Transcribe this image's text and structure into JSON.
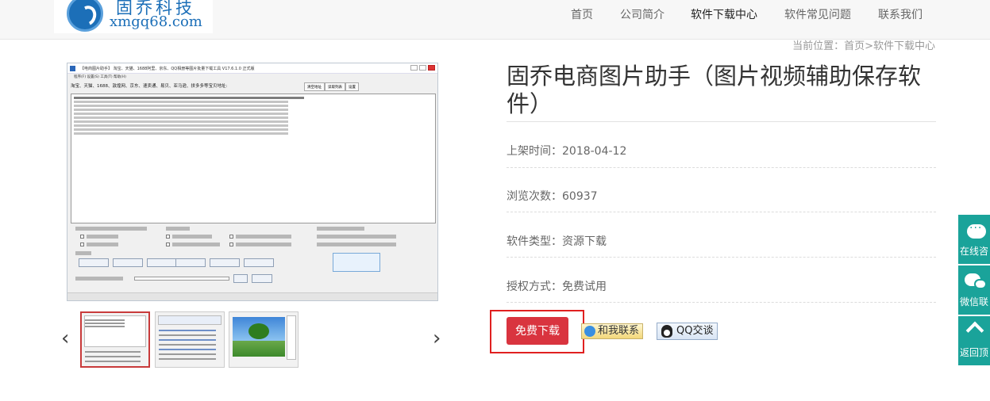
{
  "header": {
    "logo_cn": "固乔科技",
    "logo_url": "xmgq68.com",
    "nav": [
      "首页",
      "公司简介",
      "软件下载中心",
      "软件常见问题",
      "联系我们"
    ],
    "nav_active": "软件下载中心"
  },
  "breadcrumb": "当前位置：首页>软件下载中心",
  "product": {
    "title": "固乔电商图片助手（图片视频辅助保存软件）",
    "release": "上架时间：2018-04-12",
    "views": "浏览次数：60937",
    "type": "软件类型：资源下载",
    "license": "授权方式：免费试用"
  },
  "actions": {
    "download": "免费下载",
    "contact": "和我联系",
    "qq": "QQ交谈"
  },
  "screenshot": {
    "window_title": "【电商图片助手】 淘宝、天猫、1688阿里、京东、QQ相册等图片批量下载工具 V17.6.1.0 正式版",
    "menu": "程序(F)    设置(S)    工具(T)    帮助(H)",
    "url_label": "淘宝、天猫、1688、敦煌网、京东、速卖通、易贝、亚马逊、拼多多等宝贝地址:",
    "btn_clear": "清空地址",
    "btn_read": "读取列表",
    "btn_set": "设置"
  },
  "side": {
    "online": "在线咨",
    "wechat": "微信联",
    "top": "返回顶"
  },
  "colors": {
    "accent_red": "#d9343f",
    "side_teal": "#1aa39a",
    "brand_blue": "#1c6fb8"
  }
}
